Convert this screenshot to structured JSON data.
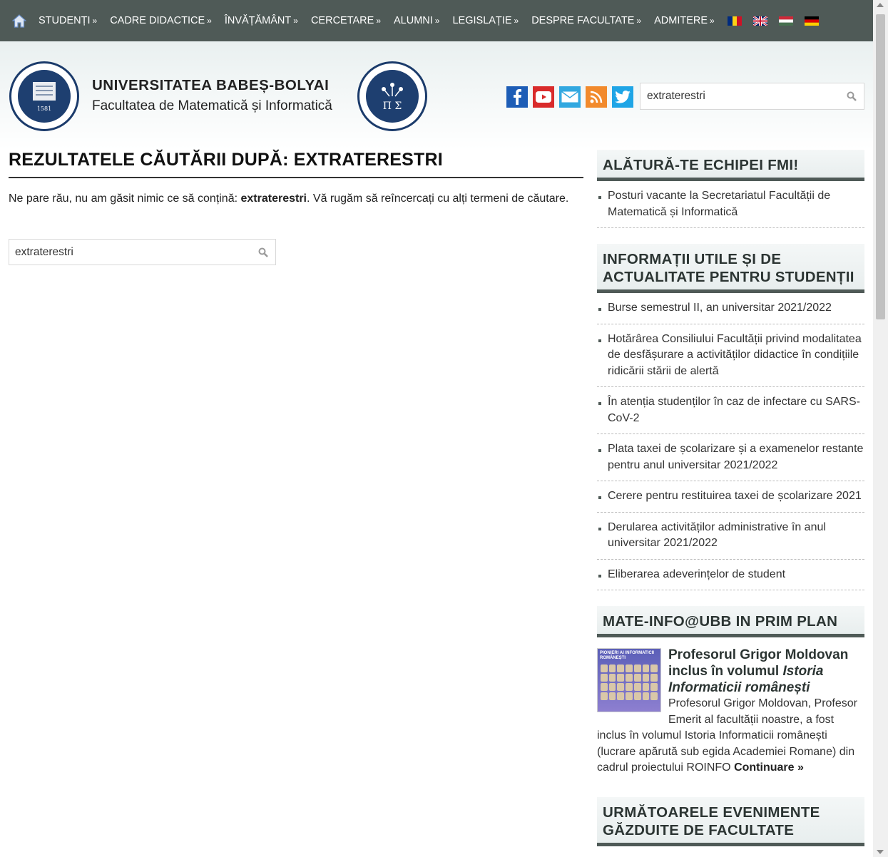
{
  "nav": {
    "home_icon": "home-icon",
    "items": [
      {
        "label": "STUDENȚI",
        "chev": "»"
      },
      {
        "label": "CADRE DIDACTICE",
        "chev": "»"
      },
      {
        "label": "ÎNVĂȚĂMÂNT",
        "chev": "»"
      },
      {
        "label": "CERCETARE",
        "chev": "»"
      },
      {
        "label": "ALUMNI",
        "chev": "»"
      },
      {
        "label": "LEGISLAȚIE",
        "chev": "»"
      },
      {
        "label": "DESPRE FACULTATE",
        "chev": "»"
      },
      {
        "label": "ADMITERE",
        "chev": "»"
      }
    ],
    "flags": [
      "romania-flag-icon",
      "uk-flag-icon",
      "hungary-flag-icon",
      "germany-flag-icon"
    ],
    "bg_color": "#4f5a57"
  },
  "header": {
    "university": "UNIVERSITATEA BABEȘ-BOLYAI",
    "faculty": "Facultatea de Matematică și Informatică",
    "socials": [
      "facebook-icon",
      "youtube-icon",
      "email-icon",
      "rss-icon",
      "twitter-icon"
    ],
    "search_value": "extraterestri"
  },
  "main": {
    "title": "REZULTATELE CĂUTĂRII DUPĂ: EXTRATERESTRI",
    "msg_prefix": "Ne pare rău, nu am găsit nimic ce să conțină: ",
    "msg_term": "extraterestri",
    "msg_suffix": ". Vă rugăm să reîncercați cu alți termeni de căutare.",
    "search_value": "extraterestri"
  },
  "sidebar": {
    "w1_title": "ALĂTURĂ-TE ECHIPEI FMI!",
    "w1_items": [
      "Posturi vacante la Secretariatul Facultății de Matematică și Informatică"
    ],
    "w2_title": "INFORMAȚII UTILE ȘI DE ACTUALITATE PENTRU STUDENȚII",
    "w2_items": [
      "Burse semestrul II, an universitar 2021/2022",
      "Hotărârea Consiliului Facultății privind modalitatea de desfășurare a activităților didactice în condițiile ridicării stării de alertă",
      "În atenția studenților în caz de infectare cu SARS-CoV-2",
      "Plata taxei de școlarizare și a examenelor restante pentru anul universitar 2021/2022",
      "Cerere pentru restituirea taxei de școlarizare 2021",
      "Derularea activităților administrative în anul universitar 2021/2022",
      "Eliberarea adeverințelor de student"
    ],
    "w3_title": "MATE-INFO@UBB IN PRIM PLAN",
    "feature": {
      "title_plain": "Profesorul Grigor Moldovan inclus în volumul ",
      "title_italic": "Istoria Informaticii românești",
      "text": "Profesorul Grigor Moldovan, Profesor Emerit al facultății noastre, a fost inclus în volumul Istoria Informaticii românești (lucrare apărută sub egida Academiei Romane) din cadrul proiectului ROINFO ",
      "more": "Continuare »",
      "img_caption": "PIONIERI AI INFORMATICII ROMÂNEȘTI"
    },
    "w4_title": "URMĂTOARELE EVENIMENTE GĂZDUITE DE FACULTATE"
  }
}
